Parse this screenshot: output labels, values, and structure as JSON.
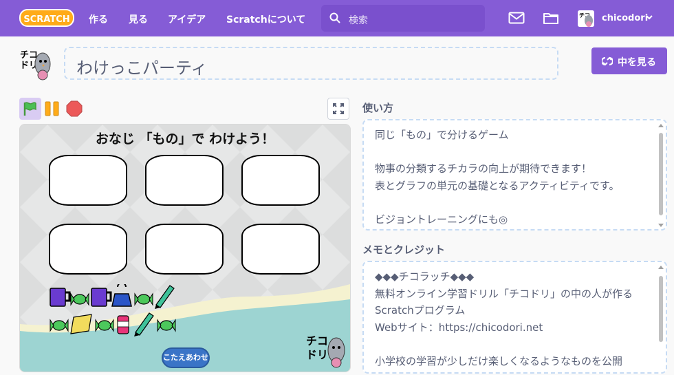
{
  "nav": {
    "logo": "SCRATCH",
    "links": [
      "作る",
      "見る",
      "アイデア",
      "Scratchについて"
    ],
    "search_placeholder": "検索",
    "username": "chicodori"
  },
  "project": {
    "title": "わけっこパーティ",
    "see_inside_label": "中を見る"
  },
  "stage": {
    "heading": "おなじ 「もの」で わけよう！",
    "answer_button": "こたえあわせ",
    "watermark": "チコドリ"
  },
  "instructions": {
    "heading": "使い方",
    "text": "同じ「もの」で分けるゲーム\n\n物事の分類するチカラの向上が期待できます！\n表とグラフの単元の基礎となるアクティビティです。\n\nビジョントレーニングにも◎"
  },
  "notes": {
    "heading": "メモとクレジット",
    "text": "◆◆◆チコラッチ◆◆◆\n無料オンライン学習ドリル「チコドリ」の中の人が作るScratchプログラム\nWebサイト：https://chicodori.net\n\n小学校の学習が少しだけ楽しくなるようなものを公開"
  },
  "colors": {
    "brand": "#855cd6",
    "flag_active_bg": "#d9ccf3",
    "pause": "#ffab19",
    "stop": "#ec5959",
    "answer_button": "#3a74c7",
    "panel_border": "#c6dbf4"
  },
  "icons": [
    "search-icon",
    "mail-icon",
    "folder-icon",
    "chevron-down-icon",
    "remix-icon",
    "green-flag-icon",
    "pause-icon",
    "stop-icon",
    "fullscreen-icon"
  ]
}
